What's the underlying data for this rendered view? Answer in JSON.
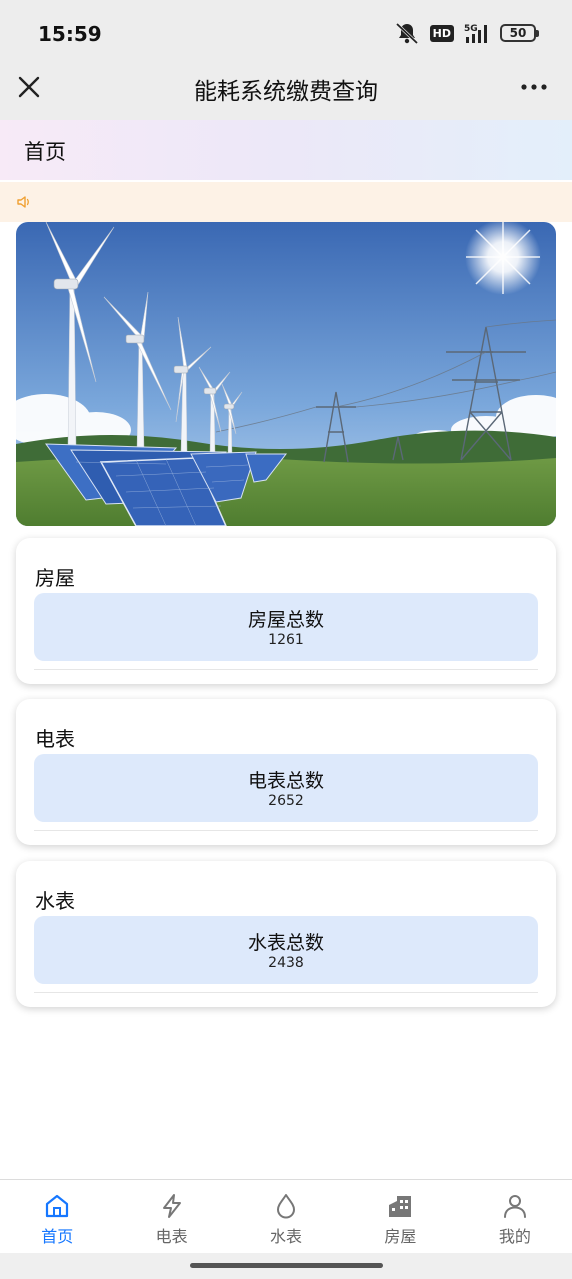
{
  "status_bar": {
    "time": "15:59",
    "hd": "HD",
    "network": "5G",
    "battery": "50"
  },
  "nav": {
    "title": "能耗系统缴费查询"
  },
  "header": {
    "title": "首页"
  },
  "cards": [
    {
      "title": "房屋",
      "stat_label": "房屋总数",
      "stat_value": "1261"
    },
    {
      "title": "电表",
      "stat_label": "电表总数",
      "stat_value": "2652"
    },
    {
      "title": "水表",
      "stat_label": "水表总数",
      "stat_value": "2438"
    }
  ],
  "tabs": [
    {
      "label": "首页",
      "icon": "home-icon",
      "active": true
    },
    {
      "label": "电表",
      "icon": "lightning-icon",
      "active": false
    },
    {
      "label": "水表",
      "icon": "water-drop-icon",
      "active": false
    },
    {
      "label": "房屋",
      "icon": "building-icon",
      "active": false
    },
    {
      "label": "我的",
      "icon": "user-icon",
      "active": false
    }
  ],
  "colors": {
    "accent": "#1677ff",
    "stat_box": "#dde9fb",
    "notice_bg": "#fdf2e6"
  }
}
